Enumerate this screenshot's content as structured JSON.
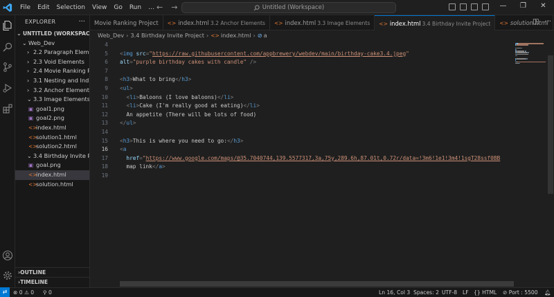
{
  "titlebar": {
    "menu": [
      "File",
      "Edit",
      "Selection",
      "View",
      "Go",
      "Run",
      "…"
    ],
    "nav_back": "←",
    "nav_forward": "→",
    "command_center": "Untitled (Workspace)",
    "window_controls": [
      "—",
      "❐",
      "✕"
    ]
  },
  "activitybar": {
    "icons": [
      "explorer-icon",
      "search-icon",
      "source-control-icon",
      "run-debug-icon",
      "extensions-icon",
      "account-icon",
      "manage-gear-icon"
    ]
  },
  "sidebar": {
    "title": "EXPLORER",
    "more": "···",
    "workspace": "UNTITLED (WORKSPACE)",
    "tree": [
      {
        "label": "Web_Dev",
        "type": "folder",
        "open": true,
        "depth": 1
      },
      {
        "label": "2.2 Paragraph Eleme...",
        "type": "folder",
        "open": false,
        "depth": 2
      },
      {
        "label": "2.3 Void Elements",
        "type": "folder",
        "open": false,
        "depth": 2
      },
      {
        "label": "2.4 Movie Ranking P...",
        "type": "folder",
        "open": false,
        "depth": 2
      },
      {
        "label": "3.1 Nesting and Ind...",
        "type": "folder",
        "open": false,
        "depth": 2
      },
      {
        "label": "3.2 Anchor Elements",
        "type": "folder",
        "open": false,
        "depth": 2
      },
      {
        "label": "3.3 Image Elements",
        "type": "folder",
        "open": true,
        "depth": 2
      },
      {
        "label": "goal1.png",
        "type": "png",
        "depth": 3
      },
      {
        "label": "goal2.png",
        "type": "png",
        "depth": 3
      },
      {
        "label": "index.html",
        "type": "html",
        "depth": 3
      },
      {
        "label": "solution1.html",
        "type": "html",
        "depth": 3
      },
      {
        "label": "solution2.html",
        "type": "html",
        "depth": 3
      },
      {
        "label": "3.4 Birthday Invite P...",
        "type": "folder",
        "open": true,
        "depth": 2
      },
      {
        "label": "goal.png",
        "type": "png",
        "depth": 3
      },
      {
        "label": "index.html",
        "type": "html",
        "depth": 3,
        "selected": true
      },
      {
        "label": "solution.html",
        "type": "html",
        "depth": 3
      }
    ],
    "outline": "OUTLINE",
    "timeline": "TIMELINE"
  },
  "tabs": [
    {
      "label": "Movie Ranking Project",
      "desc": "",
      "icon": false,
      "active": false,
      "italic": false
    },
    {
      "label": "index.html",
      "desc": "3.2 Anchor Elements",
      "icon": true,
      "active": false,
      "italic": false
    },
    {
      "label": "index.html",
      "desc": "3.3 Image Elements",
      "icon": true,
      "active": false,
      "italic": false
    },
    {
      "label": "index.html",
      "desc": "3.4 Birthday Invite Project",
      "icon": true,
      "active": true,
      "italic": false
    },
    {
      "label": "solution.html",
      "desc": "",
      "icon": true,
      "active": false,
      "italic": true
    }
  ],
  "breadcrumb": {
    "parts": [
      "Web_Dev",
      "3.4 Birthday Invite Project",
      "index.html",
      "a"
    ]
  },
  "editor": {
    "current_line": 16,
    "lines": [
      {
        "n": 4,
        "tokens": []
      },
      {
        "n": 5,
        "tokens": [
          [
            "punc",
            "<"
          ],
          [
            "tag",
            "img"
          ],
          [
            "text",
            " "
          ],
          [
            "attr",
            "src"
          ],
          [
            "punc",
            "="
          ],
          [
            "str",
            "\""
          ],
          [
            "strlink",
            "https://raw.githubusercontent.com/appbrewery/webdev/main/birthday-cake3.4.jpeg"
          ],
          [
            "str",
            "\""
          ]
        ]
      },
      {
        "n": 6,
        "tokens": [
          [
            "attr",
            "alt"
          ],
          [
            "punc",
            "="
          ],
          [
            "str",
            "\"purple birthday cakes with candle\""
          ],
          [
            "text",
            " "
          ],
          [
            "punc",
            "/>"
          ]
        ]
      },
      {
        "n": 7,
        "tokens": []
      },
      {
        "n": 8,
        "tokens": [
          [
            "punc",
            "<"
          ],
          [
            "tag",
            "h3"
          ],
          [
            "punc",
            ">"
          ],
          [
            "text",
            "What to bring"
          ],
          [
            "punc",
            "</"
          ],
          [
            "tag",
            "h3"
          ],
          [
            "punc",
            ">"
          ]
        ]
      },
      {
        "n": 9,
        "tokens": [
          [
            "punc",
            "<"
          ],
          [
            "tag",
            "ul"
          ],
          [
            "punc",
            ">"
          ]
        ]
      },
      {
        "n": 10,
        "tokens": [
          [
            "text",
            "  "
          ],
          [
            "punc",
            "<"
          ],
          [
            "tag",
            "li"
          ],
          [
            "punc",
            ">"
          ],
          [
            "text",
            "Baloons (I love baloons)"
          ],
          [
            "punc",
            "</"
          ],
          [
            "tag",
            "li"
          ],
          [
            "punc",
            ">"
          ]
        ]
      },
      {
        "n": 11,
        "tokens": [
          [
            "text",
            "  "
          ],
          [
            "punc",
            "<"
          ],
          [
            "tag",
            "li"
          ],
          [
            "punc",
            ">"
          ],
          [
            "text",
            "Cake (I'm really good at eating)"
          ],
          [
            "punc",
            "</"
          ],
          [
            "tag",
            "li"
          ],
          [
            "punc",
            ">"
          ]
        ]
      },
      {
        "n": 12,
        "tokens": [
          [
            "text",
            "  An appetite (There will be lots of food)"
          ]
        ]
      },
      {
        "n": 13,
        "tokens": [
          [
            "punc",
            "</"
          ],
          [
            "tag",
            "ul"
          ],
          [
            "punc",
            ">"
          ]
        ]
      },
      {
        "n": 14,
        "tokens": []
      },
      {
        "n": 15,
        "tokens": [
          [
            "punc",
            "<"
          ],
          [
            "tag",
            "h3"
          ],
          [
            "punc",
            ">"
          ],
          [
            "text",
            "This is where you need to go:"
          ],
          [
            "punc",
            "</"
          ],
          [
            "tag",
            "h3"
          ],
          [
            "punc",
            ">"
          ]
        ]
      },
      {
        "n": 16,
        "tokens": [
          [
            "punc",
            "<"
          ],
          [
            "tag",
            "a"
          ]
        ]
      },
      {
        "n": 17,
        "tokens": [
          [
            "text",
            "  "
          ],
          [
            "attr",
            "href"
          ],
          [
            "punc",
            "="
          ],
          [
            "str",
            "\""
          ],
          [
            "strlink",
            "https://www.google.com/maps/@35.7040744,139.5577317,3a,75y,289.6h,87.01t,0.72r/data=!3m6!1e1!3m4!1sgT28ssf0BB"
          ]
        ]
      },
      {
        "n": 18,
        "tokens": [
          [
            "text",
            "  map link"
          ],
          [
            "punc",
            "</"
          ],
          [
            "tag",
            "a"
          ],
          [
            "punc",
            ">"
          ]
        ]
      },
      {
        "n": 19,
        "tokens": []
      }
    ]
  },
  "statusbar": {
    "remote": "⇄",
    "errors": "0",
    "warnings": "0",
    "ports": "0",
    "position": "Ln 16, Col 3",
    "spaces": "Spaces: 2",
    "encoding": "UTF-8",
    "eol": "LF",
    "language": "HTML",
    "port": "Port : 5500"
  }
}
